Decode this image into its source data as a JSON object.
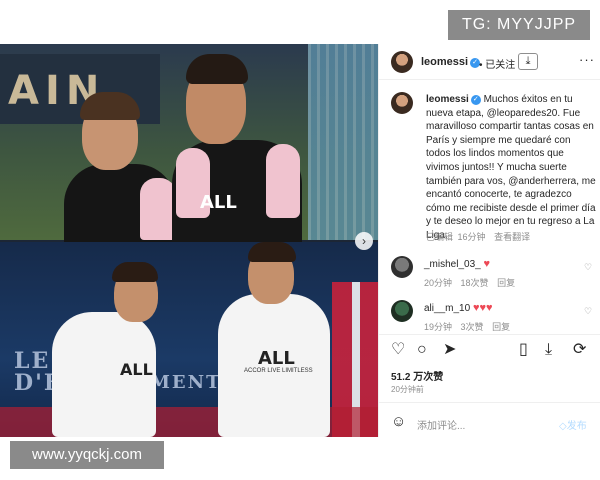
{
  "watermarks": {
    "top_right": "TG: MYYJJPP",
    "bottom_left": "www.yyqckj.com"
  },
  "photo": {
    "top_wall_text": "AIN",
    "bottom_wall_text_line1": "LE",
    "bottom_wall_text_line2": "D'E",
    "bottom_wall_text_line3": "MENT",
    "jersey_text": "ALL",
    "jersey_sponsor": "ACCOR LIVE LIMITLESS"
  },
  "post": {
    "header": {
      "username": "leomessi",
      "verified_icon": "verified-badge-icon",
      "follow_label": "已关注",
      "separator": "•"
    },
    "caption": {
      "username": "leomessi",
      "text": "Muchos éxitos en tu nueva etapa, @leoparedes20. Fue maravilloso compartir tantas cosas en París y siempre me quedaré con todos los lindos momentos que vivimos juntos!! Y mucha suerte también para vos, @anderherrera, me encantó conocerte, te agradezco cómo me recibiste desde el primer día y te deseo lo mejor en tu regreso a La Liga."
    },
    "caption_meta": {
      "edited": "已编辑",
      "time": "16分钟",
      "translate": "查看翻译"
    },
    "comments": [
      {
        "username": "_mishel_03_",
        "emoji": "♥",
        "time": "20分钟",
        "likes": "18次赞",
        "reply": "回复"
      },
      {
        "username": "ali__m_10",
        "emoji": "♥♥♥",
        "time": "19分钟",
        "likes": "3次赞",
        "reply": "回复"
      }
    ],
    "likes": "51.2 万次赞",
    "timestamp": "20分钟前",
    "add_comment_placeholder": "添加评论...",
    "post_label": "发布"
  },
  "colors": {
    "verified": "#3897f0",
    "heart": "#ed4956",
    "post_disabled": "#b3dbff"
  }
}
